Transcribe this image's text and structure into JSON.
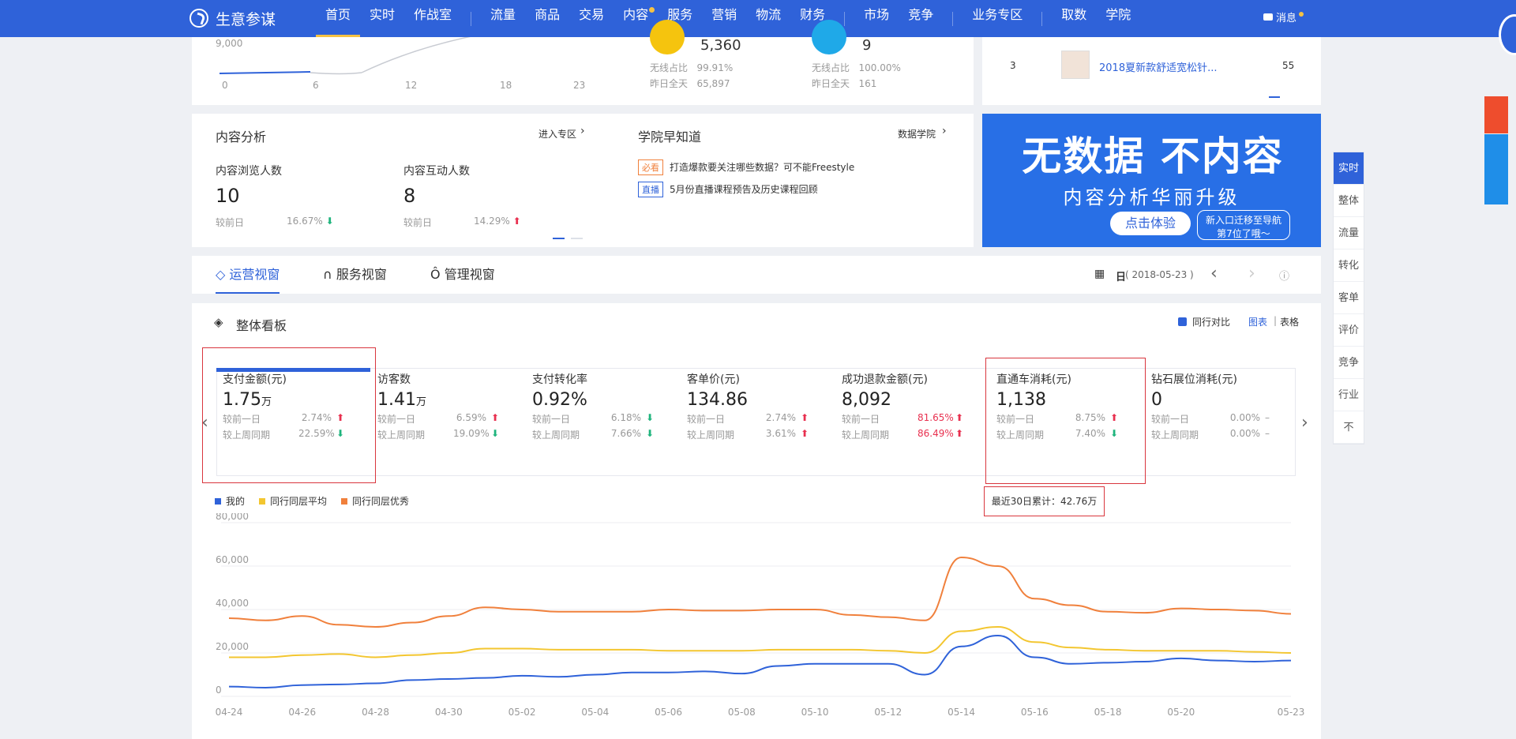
{
  "brand": "生意参谋",
  "nav": [
    "首页",
    "实时",
    "作战室",
    "流量",
    "商品",
    "交易",
    "内容",
    "服务",
    "营销",
    "物流",
    "财务",
    "市场",
    "竞争",
    "业务专区",
    "取数",
    "学院"
  ],
  "message": "消息",
  "top_chart": {
    "ytick": "9,000",
    "xticks": [
      "0",
      "6",
      "12",
      "18",
      "23"
    ]
  },
  "stats": [
    {
      "value": "5,360",
      "wireless_label": "无线占比",
      "wireless": "99.91%",
      "yesterday_label": "昨日全天",
      "yesterday": "65,897"
    },
    {
      "value": "9",
      "wireless_label": "无线占比",
      "wireless": "100.00%",
      "yesterday_label": "昨日全天",
      "yesterday": "161"
    }
  ],
  "rank": {
    "no": "3",
    "title": "2018夏新款舒适宽松针...",
    "value": "55"
  },
  "content": {
    "title": "内容分析",
    "link": "进入专区",
    "m1": {
      "label": "内容浏览人数",
      "value": "10",
      "cmp": "较前日",
      "pct": "16.67%"
    },
    "m2": {
      "label": "内容互动人数",
      "value": "8",
      "cmp": "较前日",
      "pct": "14.29%"
    }
  },
  "academy": {
    "title": "学院早知道",
    "link": "数据学院",
    "items": [
      {
        "tag": "必看",
        "text": "打造爆款要关注哪些数据？可不能Freestyle"
      },
      {
        "tag": "直播",
        "text": "5月份直播课程预告及历史课程回顾"
      }
    ]
  },
  "banner": {
    "big": "无数据 不内容",
    "sub": "内容分析华丽升级",
    "button": "点击体验",
    "bubble1": "新入口迁移至导航",
    "bubble2": "第7位了哦～"
  },
  "tabs": [
    "运营视窗",
    "服务视窗",
    "管理视窗"
  ],
  "date": {
    "day": "日",
    "value": "( 2018-05-23 )"
  },
  "board": {
    "title": "整体看板",
    "compare": "同行对比",
    "chart": "图表",
    "table": "表格",
    "total": "最近30日累计：42.76万"
  },
  "metrics": [
    {
      "title": "支付金额(元)",
      "value": "1.75",
      "unit": "万",
      "r1": "较前一日",
      "v1": "2.74%",
      "a1": "up",
      "r2": "较上周同期",
      "v2": "22.59%",
      "a2": "down"
    },
    {
      "title": "访客数",
      "value": "1.41",
      "unit": "万",
      "r1": "较前一日",
      "v1": "6.59%",
      "a1": "up",
      "r2": "较上周同期",
      "v2": "19.09%",
      "a2": "down"
    },
    {
      "title": "支付转化率",
      "value": "0.92%",
      "unit": "",
      "r1": "较前一日",
      "v1": "6.18%",
      "a1": "down",
      "r2": "较上周同期",
      "v2": "7.66%",
      "a2": "down"
    },
    {
      "title": "客单价(元)",
      "value": "134.86",
      "unit": "",
      "r1": "较前一日",
      "v1": "2.74%",
      "a1": "up",
      "r2": "较上周同期",
      "v2": "3.61%",
      "a2": "up"
    },
    {
      "title": "成功退款金额(元)",
      "value": "8,092",
      "unit": "",
      "r1": "较前一日",
      "v1": "81.65%",
      "a1": "up",
      "r2": "较上周同期",
      "v2": "86.49%",
      "a2": "up"
    },
    {
      "title": "直通车消耗(元)",
      "value": "1,138",
      "unit": "",
      "r1": "较前一日",
      "v1": "8.75%",
      "a1": "up",
      "r2": "较上周同期",
      "v2": "7.40%",
      "a2": "down"
    },
    {
      "title": "钻石展位消耗(元)",
      "value": "0",
      "unit": "",
      "r1": "较前一日",
      "v1": "0.00%",
      "a1": "flat",
      "r2": "较上周同期",
      "v2": "0.00%",
      "a2": "flat"
    }
  ],
  "right_nav": [
    "实时",
    "整体",
    "流量",
    "转化",
    "客单",
    "评价",
    "竞争",
    "行业",
    "不"
  ],
  "chart_data": {
    "type": "line",
    "categories": [
      "04-24",
      "04-25",
      "04-26",
      "04-27",
      "04-28",
      "04-29",
      "04-30",
      "05-01",
      "05-02",
      "05-03",
      "05-04",
      "05-05",
      "05-06",
      "05-07",
      "05-08",
      "05-09",
      "05-10",
      "05-11",
      "05-12",
      "05-13",
      "05-14",
      "05-15",
      "05-16",
      "05-17",
      "05-18",
      "05-19",
      "05-20",
      "05-21",
      "05-22",
      "05-23"
    ],
    "xticks": [
      "04-24",
      "04-26",
      "04-28",
      "04-30",
      "05-02",
      "05-04",
      "05-06",
      "05-08",
      "05-10",
      "05-12",
      "05-14",
      "05-16",
      "05-18",
      "05-20",
      "05-23"
    ],
    "yticks": [
      "80,000",
      "60,000",
      "40,000",
      "20,000",
      "0"
    ],
    "ylim": [
      0,
      80000
    ],
    "series": [
      {
        "name": "我的",
        "color": "#2f62d9",
        "values": [
          4500,
          4000,
          5200,
          5500,
          6000,
          7500,
          8000,
          8500,
          9500,
          9000,
          10000,
          11000,
          11000,
          11500,
          10500,
          14000,
          15000,
          15000,
          15000,
          10000,
          23000,
          28000,
          18000,
          15000,
          15500,
          16000,
          17500,
          16500,
          16000,
          16500
        ]
      },
      {
        "name": "同行同层平均",
        "color": "#f3c630",
        "values": [
          18000,
          18000,
          19000,
          19500,
          18000,
          19000,
          20000,
          22000,
          22000,
          21500,
          21500,
          21500,
          21000,
          21000,
          21000,
          21500,
          21500,
          21500,
          21000,
          20000,
          30000,
          32000,
          25000,
          22500,
          21500,
          21000,
          21000,
          21000,
          20500,
          20000
        ]
      },
      {
        "name": "同行同层优秀",
        "color": "#f0803c",
        "values": [
          36000,
          35000,
          37000,
          33000,
          32000,
          34000,
          37000,
          41000,
          40000,
          39000,
          39000,
          39000,
          40000,
          39500,
          39500,
          40000,
          40000,
          37500,
          36500,
          35000,
          64000,
          60000,
          45000,
          42000,
          39000,
          38500,
          40500,
          40000,
          39500,
          38000
        ]
      }
    ]
  }
}
